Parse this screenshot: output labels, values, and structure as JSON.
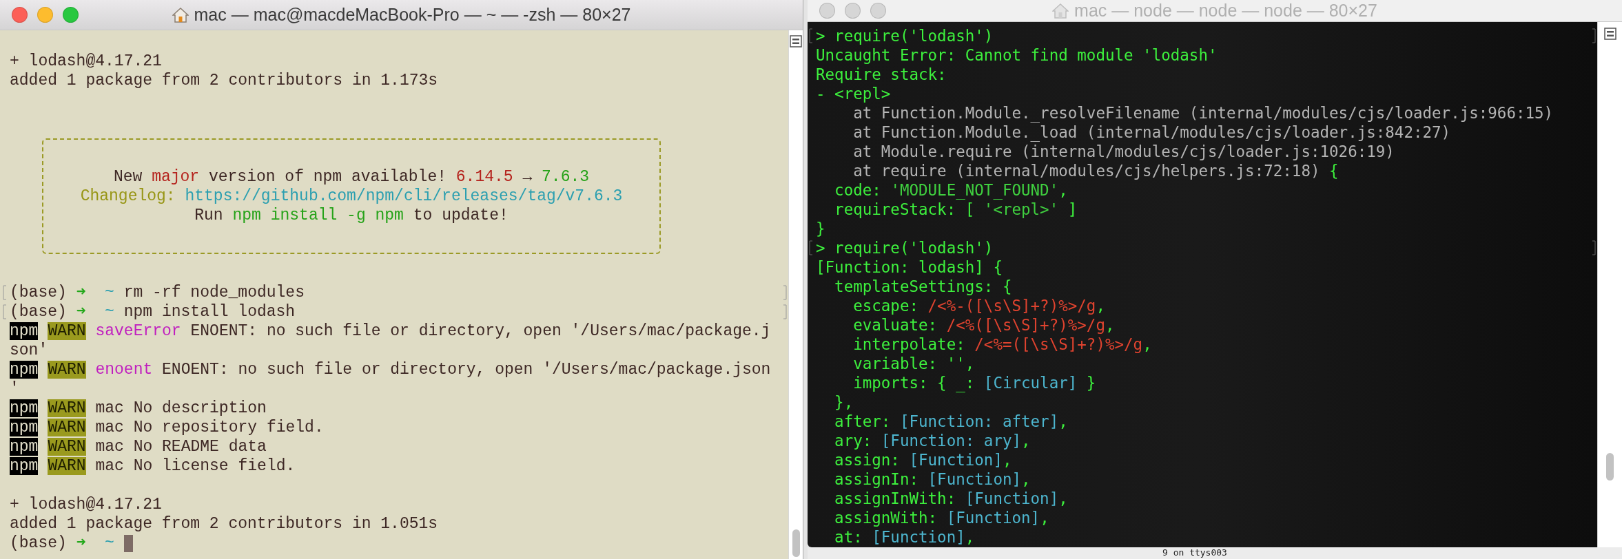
{
  "windows": [
    {
      "title": "mac — mac@macdeMacBook-Pro — ~ — -zsh — 80×27",
      "active": true,
      "lines": [
        {
          "kind": "blank"
        },
        {
          "kind": "text",
          "marked": false,
          "segs": [
            {
              "kind": "plain",
              "text": "+ lodash@4.17.21"
            }
          ]
        },
        {
          "kind": "text",
          "marked": false,
          "segs": [
            {
              "kind": "plain",
              "text": "added 1 package from 2 contributors in 1.173s"
            }
          ]
        },
        {
          "kind": "blank"
        },
        {
          "kind": "blank"
        },
        {
          "kind": "notice",
          "lines": [
            {
              "kind": "blank"
            },
            {
              "kind": "text",
              "segs": [
                {
                  "kind": "plain",
                  "text": "New "
                },
                {
                  "kind": "red",
                  "text": "major"
                },
                {
                  "kind": "plain",
                  "text": " version of npm available! "
                },
                {
                  "kind": "red",
                  "text": "6.14.5"
                },
                {
                  "kind": "plain",
                  "text": " → "
                },
                {
                  "kind": "green",
                  "text": "7.6.3"
                }
              ]
            },
            {
              "kind": "text",
              "segs": [
                {
                  "kind": "olive",
                  "text": "Changelog: "
                },
                {
                  "kind": "cyan",
                  "text": "https://github.com/npm/cli/releases/tag/v7.6.3"
                }
              ]
            },
            {
              "kind": "text",
              "segs": [
                {
                  "kind": "plain",
                  "text": "Run "
                },
                {
                  "kind": "green",
                  "text": "npm install -g npm"
                },
                {
                  "kind": "plain",
                  "text": " to update!"
                }
              ]
            },
            {
              "kind": "blank"
            }
          ]
        },
        {
          "kind": "blank"
        },
        {
          "kind": "text",
          "marked": true,
          "segs": [
            {
              "kind": "plain",
              "text": "(base) "
            },
            {
              "kind": "arrow",
              "text": "➜"
            },
            {
              "kind": "cyan",
              "text": "  ~"
            },
            {
              "kind": "plain",
              "text": " rm -rf node_modules"
            }
          ]
        },
        {
          "kind": "text",
          "marked": true,
          "segs": [
            {
              "kind": "plain",
              "text": "(base) "
            },
            {
              "kind": "arrow",
              "text": "➜"
            },
            {
              "kind": "cyan",
              "text": "  ~"
            },
            {
              "kind": "plain",
              "text": " npm install lodash"
            }
          ]
        },
        {
          "kind": "text",
          "marked": false,
          "segs": [
            {
              "kind": "npm",
              "text": "npm"
            },
            {
              "kind": "warn",
              "text": "WARN"
            },
            {
              "kind": "magenta",
              "text": " saveError"
            },
            {
              "kind": "plain",
              "text": " ENOENT: no such file or directory, open '/Users/mac/package.j"
            }
          ]
        },
        {
          "kind": "text",
          "marked": false,
          "segs": [
            {
              "kind": "plain",
              "text": "son'"
            }
          ]
        },
        {
          "kind": "text",
          "marked": false,
          "segs": [
            {
              "kind": "npm",
              "text": "npm"
            },
            {
              "kind": "warn",
              "text": "WARN"
            },
            {
              "kind": "magenta",
              "text": " enoent"
            },
            {
              "kind": "plain",
              "text": " ENOENT: no such file or directory, open '/Users/mac/package.json"
            }
          ]
        },
        {
          "kind": "text",
          "marked": false,
          "segs": [
            {
              "kind": "plain",
              "text": "'"
            }
          ]
        },
        {
          "kind": "text",
          "marked": false,
          "segs": [
            {
              "kind": "npm",
              "text": "npm"
            },
            {
              "kind": "warn",
              "text": "WARN"
            },
            {
              "kind": "plain",
              "text": " mac No description"
            }
          ]
        },
        {
          "kind": "text",
          "marked": false,
          "segs": [
            {
              "kind": "npm",
              "text": "npm"
            },
            {
              "kind": "warn",
              "text": "WARN"
            },
            {
              "kind": "plain",
              "text": " mac No repository field."
            }
          ]
        },
        {
          "kind": "text",
          "marked": false,
          "segs": [
            {
              "kind": "npm",
              "text": "npm"
            },
            {
              "kind": "warn",
              "text": "WARN"
            },
            {
              "kind": "plain",
              "text": " mac No README data"
            }
          ]
        },
        {
          "kind": "text",
          "marked": false,
          "segs": [
            {
              "kind": "npm",
              "text": "npm"
            },
            {
              "kind": "warn",
              "text": "WARN"
            },
            {
              "kind": "plain",
              "text": " mac No license field."
            }
          ]
        },
        {
          "kind": "blank"
        },
        {
          "kind": "text",
          "marked": false,
          "segs": [
            {
              "kind": "plain",
              "text": "+ lodash@4.17.21"
            }
          ]
        },
        {
          "kind": "text",
          "marked": false,
          "segs": [
            {
              "kind": "plain",
              "text": "added 1 package from 2 contributors in 1.051s"
            }
          ]
        },
        {
          "kind": "text",
          "marked": false,
          "cursor": true,
          "segs": [
            {
              "kind": "plain",
              "text": "(base) "
            },
            {
              "kind": "arrow",
              "text": "➜"
            },
            {
              "kind": "cyan",
              "text": "  ~"
            }
          ]
        }
      ]
    },
    {
      "title": "mac — node — node — node — 80×27",
      "active": false,
      "lines": [
        {
          "kind": "text",
          "marked": true,
          "segs": [
            {
              "kind": "lime",
              "text": "> require('lodash')"
            }
          ]
        },
        {
          "kind": "text",
          "marked": false,
          "segs": [
            {
              "kind": "lime",
              "text": "Uncaught Error: Cannot find module 'lodash'"
            }
          ]
        },
        {
          "kind": "text",
          "marked": false,
          "segs": [
            {
              "kind": "lime",
              "text": "Require stack:"
            }
          ]
        },
        {
          "kind": "text",
          "marked": false,
          "segs": [
            {
              "kind": "lime",
              "text": "- <repl>"
            }
          ]
        },
        {
          "kind": "text",
          "marked": false,
          "segs": [
            {
              "kind": "gray",
              "text": "    at Function.Module._resolveFilename (internal/modules/cjs/loader.js:966:15)"
            }
          ]
        },
        {
          "kind": "text",
          "marked": false,
          "segs": [
            {
              "kind": "gray",
              "text": "    at Function.Module._load (internal/modules/cjs/loader.js:842:27)"
            }
          ]
        },
        {
          "kind": "text",
          "marked": false,
          "segs": [
            {
              "kind": "gray",
              "text": "    at Module.require (internal/modules/cjs/loader.js:1026:19)"
            }
          ]
        },
        {
          "kind": "text",
          "marked": false,
          "segs": [
            {
              "kind": "gray",
              "text": "    at require (internal/modules/cjs/helpers.js:72:18)"
            },
            {
              "kind": "lime",
              "text": " {"
            }
          ]
        },
        {
          "kind": "text",
          "marked": false,
          "segs": [
            {
              "kind": "lime",
              "text": "  code: "
            },
            {
              "kind": "dull",
              "text": "'MODULE_NOT_FOUND'"
            },
            {
              "kind": "lime",
              "text": ","
            }
          ]
        },
        {
          "kind": "text",
          "marked": false,
          "segs": [
            {
              "kind": "lime",
              "text": "  requireStack: [ "
            },
            {
              "kind": "dull",
              "text": "'<repl>'"
            },
            {
              "kind": "lime",
              "text": " ]"
            }
          ]
        },
        {
          "kind": "text",
          "marked": false,
          "segs": [
            {
              "kind": "lime",
              "text": "}"
            }
          ]
        },
        {
          "kind": "text",
          "marked": true,
          "segs": [
            {
              "kind": "lime",
              "text": "> require('lodash')"
            }
          ]
        },
        {
          "kind": "text",
          "marked": false,
          "segs": [
            {
              "kind": "lime",
              "text": "[Function: lodash] {"
            }
          ]
        },
        {
          "kind": "text",
          "marked": false,
          "segs": [
            {
              "kind": "lime",
              "text": "  templateSettings: {"
            }
          ]
        },
        {
          "kind": "text",
          "marked": false,
          "segs": [
            {
              "kind": "lime",
              "text": "    escape: "
            },
            {
              "kind": "regex",
              "text": "/<%-([\\s\\S]+?)%>/g"
            },
            {
              "kind": "lime",
              "text": ","
            }
          ]
        },
        {
          "kind": "text",
          "marked": false,
          "segs": [
            {
              "kind": "lime",
              "text": "    evaluate: "
            },
            {
              "kind": "regex",
              "text": "/<%([\\s\\S]+?)%>/g"
            },
            {
              "kind": "lime",
              "text": ","
            }
          ]
        },
        {
          "kind": "text",
          "marked": false,
          "segs": [
            {
              "kind": "lime",
              "text": "    interpolate: "
            },
            {
              "kind": "regex",
              "text": "/<%=([\\s\\S]+?)%>/g"
            },
            {
              "kind": "lime",
              "text": ","
            }
          ]
        },
        {
          "kind": "text",
          "marked": false,
          "segs": [
            {
              "kind": "lime",
              "text": "    variable: '',"
            }
          ]
        },
        {
          "kind": "text",
          "marked": false,
          "segs": [
            {
              "kind": "lime",
              "text": "    imports: { _: "
            },
            {
              "kind": "object",
              "text": "[Circular]"
            },
            {
              "kind": "lime",
              "text": " }"
            }
          ]
        },
        {
          "kind": "text",
          "marked": false,
          "segs": [
            {
              "kind": "lime",
              "text": "  },"
            }
          ]
        },
        {
          "kind": "text",
          "marked": false,
          "segs": [
            {
              "kind": "lime",
              "text": "  after: "
            },
            {
              "kind": "object",
              "text": "[Function: after]"
            },
            {
              "kind": "lime",
              "text": ","
            }
          ]
        },
        {
          "kind": "text",
          "marked": false,
          "segs": [
            {
              "kind": "lime",
              "text": "  ary: "
            },
            {
              "kind": "object",
              "text": "[Function: ary]"
            },
            {
              "kind": "lime",
              "text": ","
            }
          ]
        },
        {
          "kind": "text",
          "marked": false,
          "segs": [
            {
              "kind": "lime",
              "text": "  assign: "
            },
            {
              "kind": "object",
              "text": "[Function]"
            },
            {
              "kind": "lime",
              "text": ","
            }
          ]
        },
        {
          "kind": "text",
          "marked": false,
          "segs": [
            {
              "kind": "lime",
              "text": "  assignIn: "
            },
            {
              "kind": "object",
              "text": "[Function]"
            },
            {
              "kind": "lime",
              "text": ","
            }
          ]
        },
        {
          "kind": "text",
          "marked": false,
          "segs": [
            {
              "kind": "lime",
              "text": "  assignInWith: "
            },
            {
              "kind": "object",
              "text": "[Function]"
            },
            {
              "kind": "lime",
              "text": ","
            }
          ]
        },
        {
          "kind": "text",
          "marked": false,
          "segs": [
            {
              "kind": "lime",
              "text": "  assignWith: "
            },
            {
              "kind": "object",
              "text": "[Function]"
            },
            {
              "kind": "lime",
              "text": ","
            }
          ]
        },
        {
          "kind": "text",
          "marked": false,
          "segs": [
            {
              "kind": "lime",
              "text": "  at: "
            },
            {
              "kind": "object",
              "text": "[Function]"
            },
            {
              "kind": "lime",
              "text": ","
            }
          ]
        }
      ]
    }
  ],
  "background_text": "9 on ttys003"
}
